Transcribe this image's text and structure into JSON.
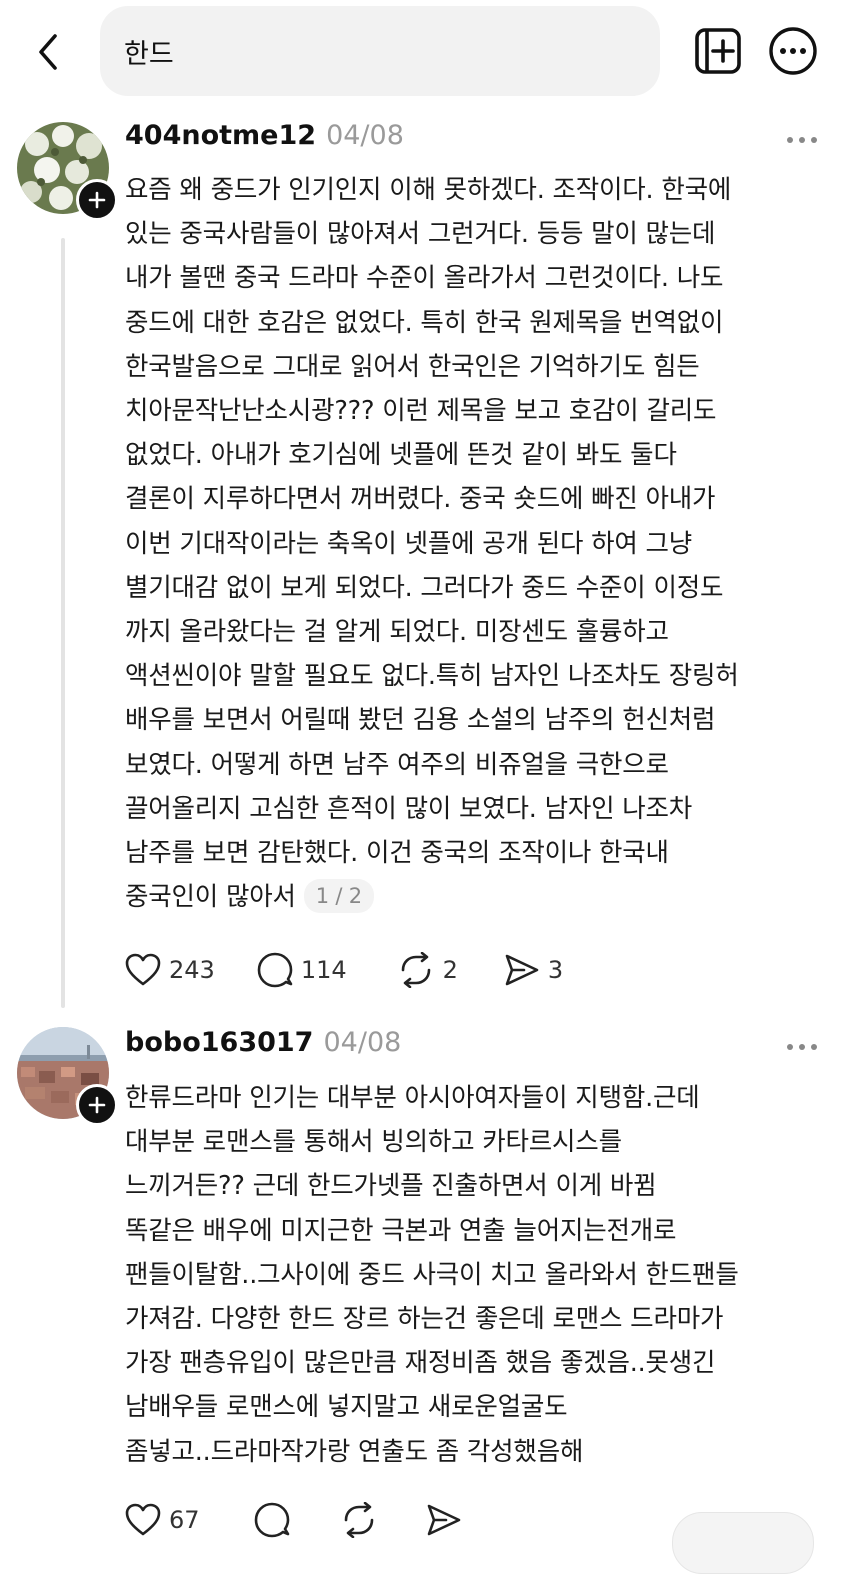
{
  "search": {
    "query": "한드"
  },
  "posts": [
    {
      "username": "404notme12",
      "date": "04/08",
      "text": "요즘 왜 중드가 인기인지 이해 못하겠다. 조작이다. 한국에\n있는 중국사람들이 많아져서 그런거다. 등등 말이 많는데\n내가 볼땐 중국 드라마 수준이 올라가서 그런것이다. 나도\n중드에 대한 호감은 없었다. 특히 한국 원제목을 번역없이\n한국발음으로 그대로 읽어서 한국인은 기억하기도 힘든\n치아문작난난소시광??? 이런 제목을 보고 호감이 갈리도\n없었다. 아내가 호기심에 넷플에 뜬것 같이 봐도 둘다\n결론이 지루하다면서 꺼버렸다. 중국 숏드에 빠진 아내가\n이번 기대작이라는 축옥이 넷플에 공개 된다 하여 그냥\n별기대감 없이 보게 되었다. 그러다가 중드 수준이 이정도\n까지 올라왔다는 걸 알게 되었다. 미장센도 훌륭하고\n액션씬이야 말할 필요도 없다.특히 남자인 나조차도 장링허\n배우를 보면서 어릴때 봤던 김용 소설의 남주의 헌신처럼\n보였다. 어떻게 하면 남주 여주의 비쥬얼을 극한으로\n끌어올리지 고심한 흔적이 많이 보였다. 남자인 나조차\n남주를 보면 감탄했다. 이건 중국의 조작이나 한국내\n중국인이 많아서",
      "page": "1 / 2",
      "likes": "243",
      "comments": "114",
      "reposts": "2",
      "shares": "3"
    },
    {
      "username": "bobo163017",
      "date": "04/08",
      "text": "한류드라마 인기는 대부분 아시아여자들이 지탱함.근데\n대부분 로맨스를 통해서 빙의하고 카타르시스를\n느끼거든?? 근데 한드가넷플 진출하면서 이게 바뀜\n똑같은 배우에 미지근한 극본과 연출 늘어지는전개로\n팬들이탈함..그사이에 중드 사극이 치고 올라와서 한드팬들\n가져감. 다양한 한드 장르 하는건 좋은데 로맨스 드라마가\n가장 팬층유입이 많은만큼 재정비좀 했음 좋겠음..못생긴\n남배우들 로맨스에 넣지말고 새로운얼굴도\n좀넣고..드라마작가랑 연출도 좀 각성했음해",
      "likes": "67"
    }
  ],
  "icons": {
    "back": "chevron-left-icon",
    "add": "add-square-icon",
    "more": "more-icon",
    "like": "heart-icon",
    "comment": "comment-icon",
    "repost": "repost-icon",
    "share": "send-icon"
  }
}
